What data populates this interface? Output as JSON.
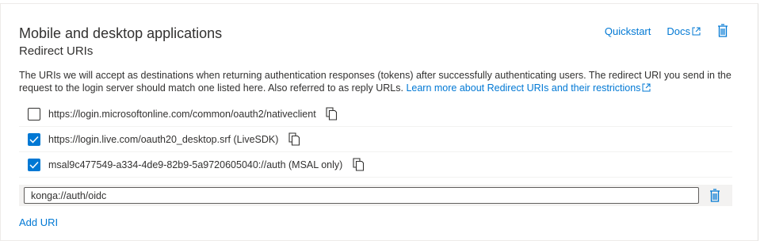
{
  "section": {
    "title": "Mobile and desktop applications",
    "subtitle": "Redirect URIs",
    "quickstart_label": "Quickstart",
    "docs_label": "Docs",
    "description": "The URIs we will accept as destinations when returning authentication responses (tokens) after successfully authenticating users. The redirect URI you send in the request to the login server should match one listed here. Also referred to as reply URLs. ",
    "learn_more_label": "Learn more about Redirect URIs and their restrictions"
  },
  "uris": [
    {
      "text": "https://login.microsoftonline.com/common/oauth2/nativeclient",
      "checked": false
    },
    {
      "text": "https://login.live.com/oauth20_desktop.srf (LiveSDK)",
      "checked": true
    },
    {
      "text": "msal9c477549-a334-4de9-82b9-5a9720605040://auth (MSAL only)",
      "checked": true
    }
  ],
  "new_uri": {
    "value": "konga://auth/oidc"
  },
  "add_uri_label": "Add URI",
  "colors": {
    "accent": "#0078d4",
    "text": "#323130",
    "row_bg": "#f3f2f1"
  },
  "icons": {
    "copy": "copy-icon",
    "trash": "trash-icon",
    "external": "external-link-icon",
    "check": "checkmark-icon"
  }
}
